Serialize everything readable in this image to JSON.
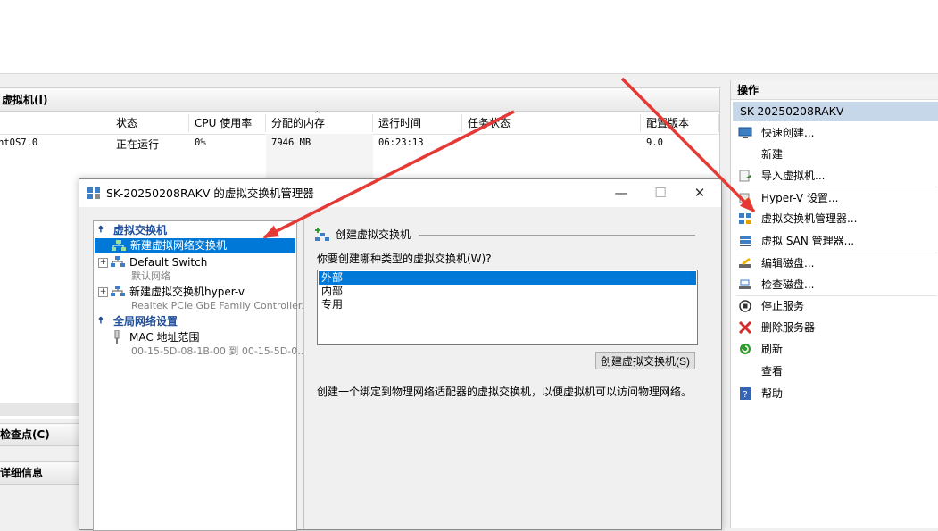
{
  "vm_panel": {
    "title": "虚拟机(I)",
    "columns": [
      "状态",
      "CPU 使用率",
      "分配的内存",
      "运行时间",
      "任务状态",
      "配置版本"
    ],
    "rows": [
      {
        "name": "ntOS7.0",
        "state": "正在运行",
        "cpu": "0%",
        "memory": "7946 MB",
        "uptime": "06:23:13",
        "task": "",
        "version": "9.0"
      }
    ]
  },
  "checkpoints_title": "检查点(C)",
  "details_title": "详细信息",
  "actions": {
    "header": "操作",
    "host": "SK-20250208RAKV",
    "items": [
      {
        "label": "快速创建...",
        "icon": "quick-create-icon"
      },
      {
        "label": "新建",
        "icon": "none"
      },
      {
        "label": "导入虚拟机...",
        "icon": "import-icon"
      },
      {
        "label": "Hyper-V 设置...",
        "icon": "settings-icon"
      },
      {
        "label": "虚拟交换机管理器...",
        "icon": "switch-manager-icon"
      },
      {
        "label": "虚拟 SAN 管理器...",
        "icon": "san-icon"
      },
      {
        "label": "编辑磁盘...",
        "icon": "edit-disk-icon"
      },
      {
        "label": "检查磁盘...",
        "icon": "inspect-disk-icon"
      },
      {
        "label": "停止服务",
        "icon": "stop-icon"
      },
      {
        "label": "删除服务器",
        "icon": "delete-icon"
      },
      {
        "label": "刷新",
        "icon": "refresh-icon"
      },
      {
        "label": "查看",
        "icon": "none"
      },
      {
        "label": "帮助",
        "icon": "help-icon"
      }
    ]
  },
  "dialog": {
    "title": "SK-20250208RAKV 的虚拟交换机管理器",
    "controls": {
      "minimize": "—",
      "maximize": "☐",
      "close": "✕"
    },
    "tree": {
      "group1": "虚拟交换机",
      "new_switch": "新建虚拟网络交换机",
      "default_switch": "Default Switch",
      "default_switch_sub": "默认网络",
      "hyperv_switch": "新建虚拟交换机hyper-v",
      "hyperv_switch_sub": "Realtek PCIe GbE Family Controller...",
      "group2": "全局网络设置",
      "mac": "MAC 地址范围",
      "mac_sub": "00-15-5D-08-1B-00 到 00-15-5D-0..."
    },
    "right": {
      "section_title": "创建虚拟交换机",
      "question": "你要创建哪种类型的虚拟交换机(W)?",
      "options": [
        "外部",
        "内部",
        "专用"
      ],
      "selected": "外部",
      "create_button": "创建虚拟交换机(S)",
      "description": "创建一个绑定到物理网络适配器的虚拟交换机，以便虚拟机可以访问物理网络。"
    }
  },
  "colors": {
    "selection": "#0078d7",
    "host_highlight": "#c7d7ea",
    "group_text": "#1f4e9b",
    "arrow": "#e53935"
  }
}
